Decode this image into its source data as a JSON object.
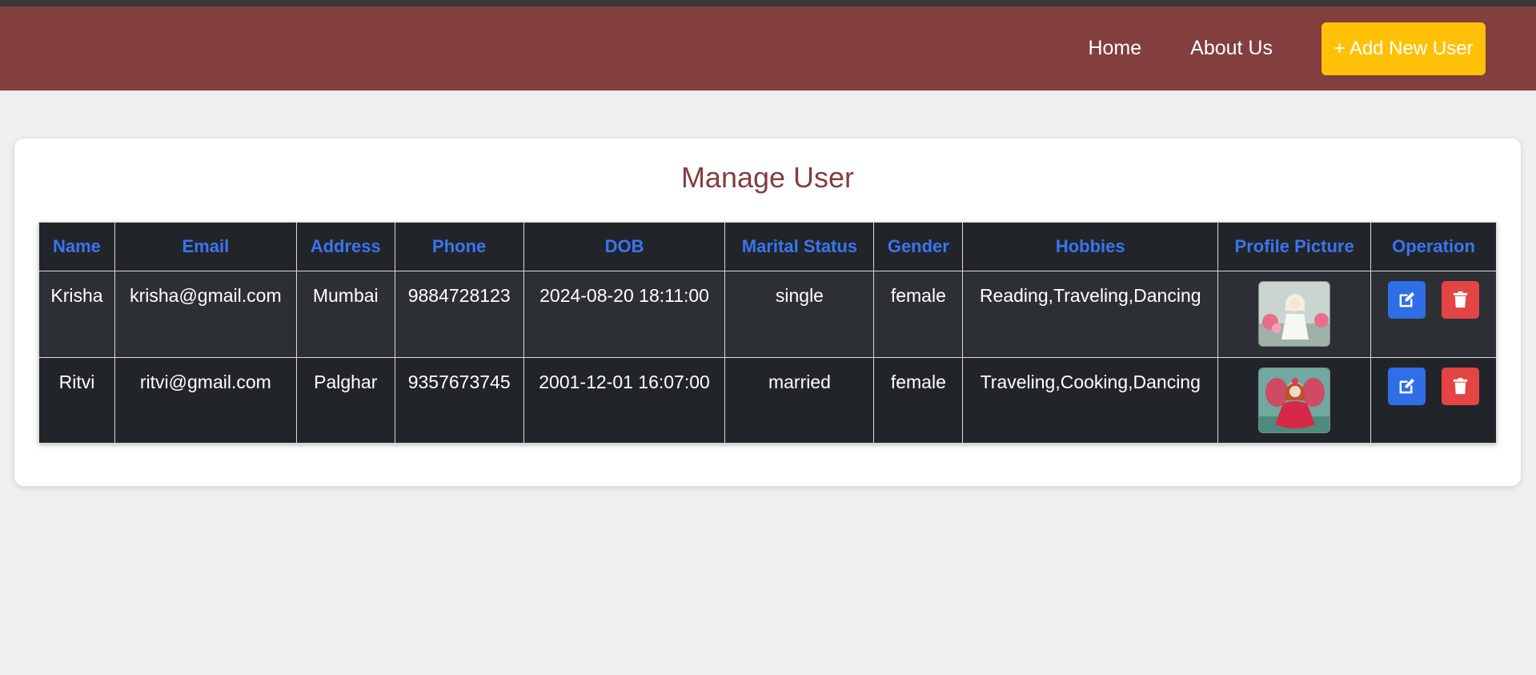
{
  "navbar": {
    "links": [
      "Home",
      "About Us"
    ],
    "add_button_label": "+ Add New User",
    "background_color": "#833e3e",
    "button_color": "#ffc107"
  },
  "page": {
    "title": "Manage User"
  },
  "table": {
    "headers": [
      "Name",
      "Email",
      "Address",
      "Phone",
      "DOB",
      "Marital Status",
      "Gender",
      "Hobbies",
      "Profile Picture",
      "Operation"
    ],
    "rows": [
      {
        "name": "Krisha",
        "email": "krisha@gmail.com",
        "address": "Mumbai",
        "phone": "9884728123",
        "dob": "2024-08-20 18:11:00",
        "marital_status": "single",
        "gender": "female",
        "hobbies": "Reading,Traveling,Dancing",
        "profile_picture": "doll-white-dress-photo"
      },
      {
        "name": "Ritvi",
        "email": "ritvi@gmail.com",
        "address": "Palghar",
        "phone": "9357673745",
        "dob": "2001-12-01 16:07:00",
        "marital_status": "married",
        "gender": "female",
        "hobbies": "Traveling,Cooking,Dancing",
        "profile_picture": "doll-red-dress-photo"
      }
    ],
    "operations": {
      "edit_icon": "edit-icon",
      "delete_icon": "trash-icon",
      "edit_color": "#2f6ee6",
      "delete_color": "#e34444"
    },
    "header_text_color": "#3b74f0"
  }
}
